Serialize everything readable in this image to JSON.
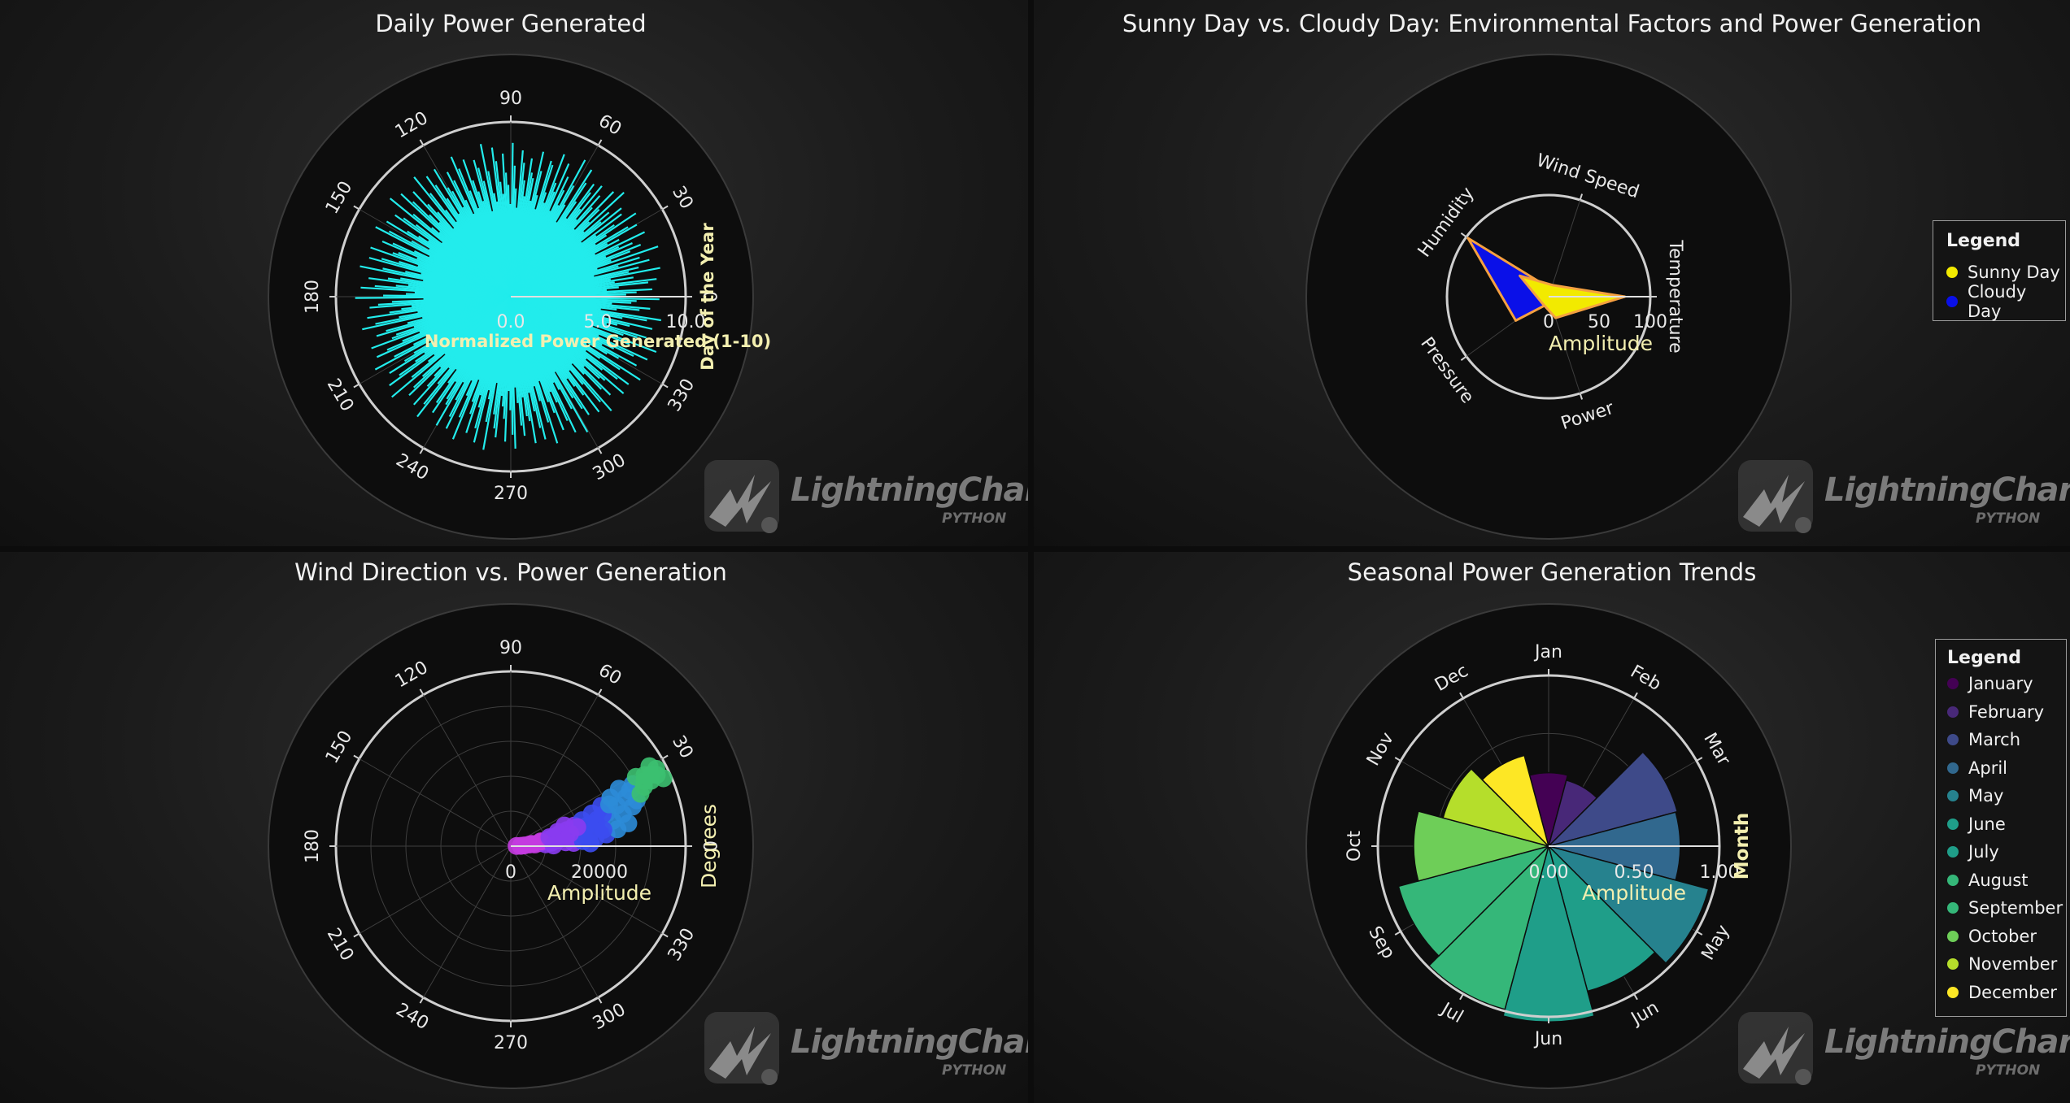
{
  "watermark": {
    "brand": "LightningChart",
    "reg": "®",
    "sub": "PYTHON"
  },
  "chart_data": [
    {
      "type": "polar-bar",
      "title": "Daily Power Generated",
      "angle_ticks": [
        "90",
        "60",
        "30",
        "0",
        "330",
        "300",
        "270",
        "240",
        "210",
        "180",
        "150",
        "120"
      ],
      "radial_ticks": [
        "0.0",
        "5.0",
        "10.0"
      ],
      "radial_label": "Normalized Power Generated (1-10)",
      "angular_label": "Day of the Year",
      "color": "#22ecec",
      "rmax": 10,
      "n_days": 365,
      "power_values": [
        4.8,
        6.6,
        7.2,
        8.1,
        5.5,
        6.2,
        7.9,
        8.4,
        6.0,
        7.1,
        5.8,
        8.7,
        6.9,
        7.5,
        4.9,
        8.2,
        6.4,
        7.7,
        5.2,
        8.9,
        6.1,
        7.3,
        8.0,
        5.9,
        7.6,
        6.8,
        8.5,
        5.4,
        7.0,
        6.3,
        8.3,
        7.8,
        5.7,
        6.5,
        8.6,
        7.2,
        6.0,
        7.9,
        5.1,
        8.1,
        6.7,
        7.4,
        5.6,
        8.8,
        6.2,
        7.1,
        8.4,
        5.3,
        6.9,
        7.7,
        5.8,
        8.2,
        6.4,
        7.5,
        8.0,
        5.5,
        6.6,
        7.8,
        8.6,
        5.0,
        6.1,
        7.3,
        8.9,
        5.9,
        6.8,
        7.6,
        5.4,
        8.3,
        6.5,
        7.0,
        8.7,
        5.7,
        6.3,
        7.9,
        8.1,
        5.2,
        6.0,
        7.4,
        8.5,
        5.6,
        6.9,
        7.2,
        8.0,
        5.8,
        6.7,
        7.7,
        8.4,
        5.1,
        6.2,
        7.5,
        8.8,
        5.3,
        6.4,
        7.1,
        8.2,
        5.9,
        6.6,
        7.8,
        8.6,
        5.5,
        6.0,
        7.3,
        8.9,
        5.0,
        6.8,
        7.6,
        8.1,
        5.7,
        6.3,
        7.0,
        8.3,
        5.4,
        6.5,
        7.9,
        8.7,
        5.2,
        6.1,
        7.4,
        8.0,
        5.8,
        6.9,
        7.2,
        8.5,
        5.6,
        6.7,
        7.7,
        8.4,
        5.3,
        6.2,
        7.5,
        8.8,
        5.1,
        6.4,
        7.1,
        8.2,
        5.9,
        6.6,
        7.8,
        8.6,
        5.5,
        6.0,
        7.3,
        8.9,
        5.0,
        6.8,
        7.6,
        8.1,
        5.7,
        6.3,
        7.0,
        8.3,
        5.4,
        6.5,
        7.9,
        8.7,
        5.2,
        6.1,
        7.4,
        8.0,
        5.8,
        6.9,
        7.2,
        8.5,
        5.6,
        6.7,
        7.7,
        8.4,
        5.3,
        6.2,
        7.5,
        8.8,
        5.1,
        6.4,
        7.1,
        8.2,
        5.9,
        6.6,
        7.8,
        8.6,
        5.5,
        6.0,
        7.3,
        8.9,
        5.0,
        6.8,
        7.6,
        8.1,
        5.7,
        6.3,
        7.0,
        8.3,
        5.4,
        6.5,
        7.9,
        8.7,
        5.2,
        6.1,
        7.4,
        8.0,
        5.8,
        6.9,
        7.2,
        8.5,
        5.6,
        6.7,
        7.7,
        8.4,
        5.3,
        6.2,
        7.5,
        8.8,
        5.1,
        6.4,
        7.1,
        8.2,
        5.9,
        6.6,
        7.8,
        8.6,
        5.5,
        6.0,
        7.3,
        8.9,
        5.0,
        6.8,
        7.6,
        8.1,
        5.7,
        6.3,
        7.0,
        8.3,
        5.4,
        6.5,
        7.9,
        8.7,
        5.2,
        6.1,
        7.4,
        8.0,
        5.8,
        6.9,
        7.2,
        8.5,
        5.6,
        6.7,
        7.7,
        8.4,
        5.3,
        6.2,
        7.5,
        8.8,
        5.1,
        6.4,
        7.1,
        8.2,
        5.9,
        6.6,
        7.8,
        8.6,
        5.5,
        6.0,
        7.3,
        8.9,
        5.0,
        6.8,
        7.6,
        8.1,
        5.7,
        6.3,
        7.0,
        8.3,
        5.4,
        6.5,
        7.9,
        8.7,
        5.2,
        6.1,
        7.4,
        8.0,
        5.8,
        6.9,
        7.2,
        8.5,
        5.6,
        6.7,
        7.7,
        8.4,
        5.3,
        6.2,
        7.5,
        8.8,
        5.1,
        6.4,
        7.1,
        8.2,
        5.9,
        6.6,
        7.8,
        8.6,
        5.5,
        6.0,
        7.3,
        8.9,
        5.0,
        6.8,
        7.6,
        8.1,
        5.7,
        6.3,
        7.0,
        8.3,
        5.4,
        6.5,
        7.9,
        8.7,
        5.2,
        6.1,
        7.4,
        8.0,
        5.8,
        6.9,
        7.2,
        8.5,
        5.6,
        6.7,
        7.7,
        8.4,
        5.3,
        6.2,
        7.5,
        8.8,
        5.1,
        6.4,
        7.1,
        8.2,
        5.9,
        6.6,
        7.8,
        8.6,
        5.5,
        6.0,
        7.3,
        8.9,
        5.0,
        6.8,
        7.6,
        8.1,
        5.7,
        6.3,
        7.0,
        8.3,
        5.4,
        6.5,
        7.9,
        8.7,
        5.2,
        6.1,
        7.4,
        8.0,
        5.8,
        6.9,
        7.2,
        8.5
      ]
    },
    {
      "type": "radar",
      "title": "Sunny Day vs. Cloudy Day: Environmental Factors and Power Generation",
      "categories": [
        "Temperature",
        "Wind Speed",
        "Humidity",
        "Pressure",
        "Power"
      ],
      "category_angles": [
        0,
        72,
        144,
        216,
        288
      ],
      "radial_ticks": [
        "0",
        "50",
        "100"
      ],
      "radial_label": "Amplitude",
      "rmax": 100,
      "series": [
        {
          "name": "Sunny Day",
          "color": "#f2ea00",
          "values": [
            75,
            12,
            35,
            9,
            22
          ]
        },
        {
          "name": "Cloudy Day",
          "color": "#0a10e8",
          "values": [
            55,
            8,
            98,
            40,
            6
          ]
        }
      ],
      "legend": {
        "title": "Legend",
        "placement": "right"
      }
    },
    {
      "type": "polar-scatter",
      "title": "Wind Direction vs. Power Generation",
      "angle_ticks": [
        "90",
        "60",
        "30",
        "0",
        "330",
        "300",
        "270",
        "240",
        "210",
        "180",
        "150",
        "120"
      ],
      "radial_ticks": [
        "0",
        "20000"
      ],
      "radial_label": "Amplitude",
      "angular_label": "Degrees",
      "rmax": 45000,
      "points": [
        [
          2,
          1500
        ],
        [
          3,
          3500
        ],
        [
          5,
          4800
        ],
        [
          4,
          6200
        ],
        [
          6,
          7400
        ],
        [
          8,
          8200
        ],
        [
          3,
          9000
        ],
        [
          10,
          9800
        ],
        [
          5,
          10500
        ],
        [
          12,
          11200
        ],
        [
          7,
          12000
        ],
        [
          14,
          12800
        ],
        [
          9,
          13500
        ],
        [
          4,
          14200
        ],
        [
          16,
          15000
        ],
        [
          11,
          15800
        ],
        [
          6,
          16500
        ],
        [
          18,
          17200
        ],
        [
          13,
          18000
        ],
        [
          8,
          18800
        ],
        [
          20,
          19500
        ],
        [
          15,
          20200
        ],
        [
          10,
          21000
        ],
        [
          5,
          21800
        ],
        [
          22,
          22500
        ],
        [
          17,
          23200
        ],
        [
          12,
          24000
        ],
        [
          7,
          24800
        ],
        [
          24,
          25500
        ],
        [
          19,
          26200
        ],
        [
          14,
          27000
        ],
        [
          9,
          27800
        ],
        [
          26,
          28500
        ],
        [
          21,
          29200
        ],
        [
          16,
          30000
        ],
        [
          11,
          30800
        ],
        [
          28,
          31500
        ],
        [
          23,
          32200
        ],
        [
          18,
          33000
        ],
        [
          25,
          33800
        ],
        [
          20,
          34500
        ],
        [
          27,
          35200
        ],
        [
          22,
          36000
        ],
        [
          29,
          36800
        ],
        [
          24,
          37500
        ],
        [
          26,
          38200
        ],
        [
          28,
          39000
        ],
        [
          25,
          39800
        ],
        [
          27,
          40500
        ],
        [
          30,
          41200
        ],
        [
          26,
          41800
        ],
        [
          28,
          42400
        ],
        [
          24,
          43000
        ],
        [
          2,
          2600
        ],
        [
          6,
          5400
        ],
        [
          9,
          7800
        ],
        [
          13,
          10200
        ],
        [
          17,
          12600
        ],
        [
          21,
          14800
        ],
        [
          3,
          16200
        ],
        [
          8,
          19000
        ],
        [
          2,
          20500
        ],
        [
          15,
          22800
        ],
        [
          19,
          25000
        ],
        [
          23,
          27500
        ],
        [
          10,
          24200
        ],
        [
          4,
          18600
        ],
        [
          1,
          11000
        ],
        [
          12,
          15600
        ],
        [
          16,
          17800
        ]
      ],
      "color_scale": [
        "#c43ce0",
        "#8a3cf0",
        "#3c4cf0",
        "#2c8cd8",
        "#3cc070"
      ]
    },
    {
      "type": "polar-bar",
      "title": "Seasonal Power Generation Trends",
      "categories": [
        "January",
        "February",
        "March",
        "April",
        "May",
        "June",
        "July",
        "August",
        "September",
        "October",
        "November",
        "December"
      ],
      "angle_ticks": [
        "Jan",
        "Feb",
        "Mar",
        "Apr",
        "May",
        "Jun",
        "Jul",
        "Aug",
        "Sep",
        "Oct",
        "Nov",
        "Dec"
      ],
      "tick_text": [
        "Jan",
        "Feb",
        "Mar",
        "",
        "May",
        "Jun",
        "Jun",
        "Jul",
        "Sep",
        "Oct",
        "Nov",
        "Dec"
      ],
      "radial_ticks": [
        "0.00",
        "0.50",
        "1.00"
      ],
      "radial_label": "Amplitude",
      "angular_label": "Month",
      "rmax": 1.0,
      "values": [
        0.43,
        0.4,
        0.78,
        0.77,
        0.97,
        0.88,
        1.03,
        0.99,
        0.91,
        0.79,
        0.64,
        0.55
      ],
      "colors": [
        "#440154",
        "#482878",
        "#3e4a89",
        "#31688e",
        "#26828e",
        "#1f9e89",
        "#1f9e89",
        "#35b779",
        "#35b779",
        "#6ece58",
        "#b5de2b",
        "#fde725"
      ],
      "legend": {
        "title": "Legend",
        "placement": "right"
      }
    }
  ]
}
